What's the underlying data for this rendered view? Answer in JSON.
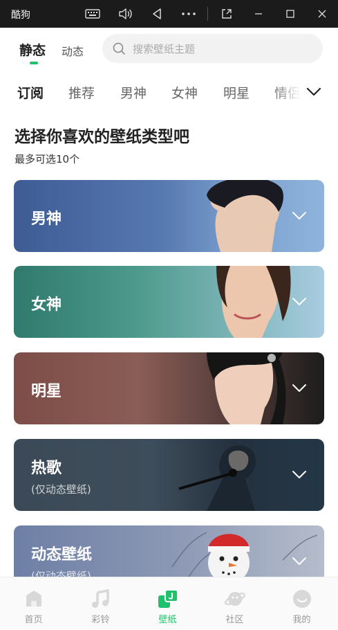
{
  "window": {
    "title": "酷狗",
    "icons": [
      "keyboard-icon",
      "volume-icon",
      "back-icon",
      "more-icon",
      "pip-icon",
      "minimize-icon",
      "maximize-icon",
      "close-icon"
    ]
  },
  "mode_tabs": [
    {
      "label": "静态",
      "active": true
    },
    {
      "label": "动态",
      "active": false
    }
  ],
  "search": {
    "placeholder": "搜索壁纸主题"
  },
  "categories": [
    {
      "label": "订阅",
      "active": true
    },
    {
      "label": "推荐",
      "active": false
    },
    {
      "label": "男神",
      "active": false
    },
    {
      "label": "女神",
      "active": false
    },
    {
      "label": "明星",
      "active": false
    },
    {
      "label": "情侣",
      "active": false
    }
  ],
  "heading": "选择你喜欢的壁纸类型吧",
  "subheading": "最多可选10个",
  "cards": [
    {
      "label": "男神",
      "sub": ""
    },
    {
      "label": "女神",
      "sub": ""
    },
    {
      "label": "明星",
      "sub": ""
    },
    {
      "label": "热歌",
      "sub": "(仅动态壁纸)"
    },
    {
      "label": "动态壁纸",
      "sub": "(仅动态壁纸)"
    }
  ],
  "bottom_nav": [
    {
      "label": "首页",
      "icon": "home-icon",
      "active": false
    },
    {
      "label": "彩铃",
      "icon": "music-note-icon",
      "active": false
    },
    {
      "label": "壁纸",
      "icon": "wallpaper-icon",
      "active": true
    },
    {
      "label": "社区",
      "icon": "planet-icon",
      "active": false
    },
    {
      "label": "我的",
      "icon": "profile-icon",
      "active": false
    }
  ],
  "colors": {
    "accent": "#1fc16b",
    "titlebar": "#1b1b1b"
  }
}
